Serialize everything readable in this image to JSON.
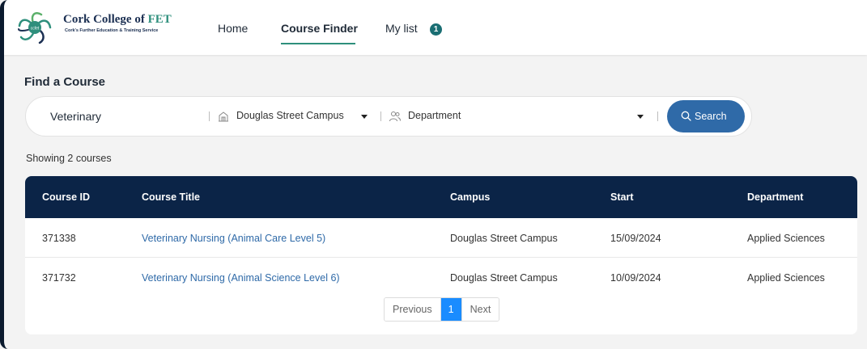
{
  "brand": {
    "name_main": "Cork College of",
    "name_accent": "FET",
    "subtitle": "Cork's Further Education & Training Service",
    "logo_text": "ccfet"
  },
  "nav": {
    "home": "Home",
    "course_finder": "Course Finder",
    "my_list": "My list",
    "my_list_count": "1"
  },
  "page": {
    "title": "Find a Course",
    "showing": "Showing 2 courses"
  },
  "search": {
    "keyword_value": "Veterinary",
    "campus_selected": "Douglas Street Campus",
    "department_placeholder": "Department",
    "button_label": "Search"
  },
  "table": {
    "headers": {
      "id": "Course ID",
      "title": "Course Title",
      "campus": "Campus",
      "start": "Start",
      "department": "Department"
    },
    "rows": [
      {
        "id": "371338",
        "title": "Veterinary Nursing (Animal Care Level 5)",
        "campus": "Douglas Street Campus",
        "start": "15/09/2024",
        "department": "Applied Sciences"
      },
      {
        "id": "371732",
        "title": "Veterinary Nursing (Animal Science Level 6)",
        "campus": "Douglas Street Campus",
        "start": "10/09/2024",
        "department": "Applied Sciences"
      }
    ]
  },
  "pagination": {
    "previous": "Previous",
    "current": "1",
    "next": "Next"
  },
  "colors": {
    "navy": "#0b2447",
    "teal": "#2e8f7c",
    "link_blue": "#2f6aa8",
    "page_active": "#1a8cff"
  },
  "icons": {
    "campus": "building-icon",
    "department": "people-icon",
    "search": "search-icon",
    "dropdown": "caret-down-icon"
  }
}
